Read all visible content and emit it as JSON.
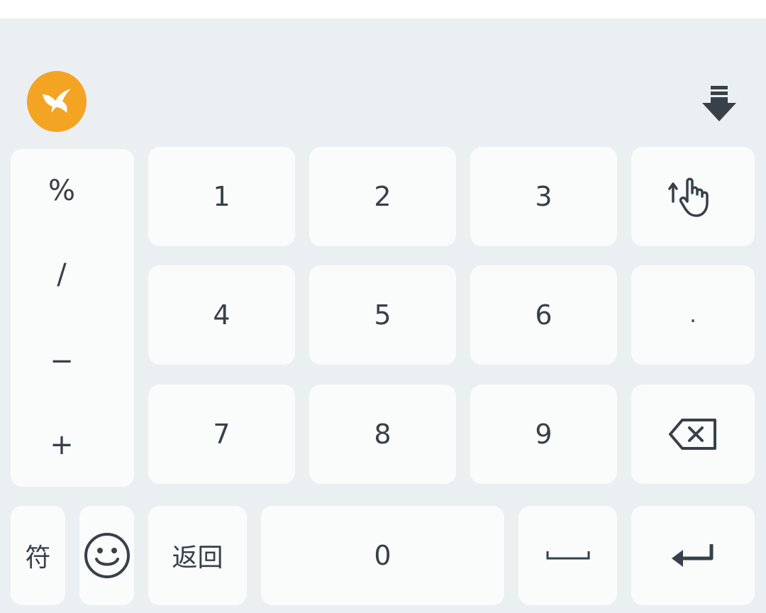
{
  "keyboard": {
    "symbols_column": [
      "%",
      "/",
      "−",
      "+"
    ],
    "digits": [
      "1",
      "2",
      "3",
      "4",
      "5",
      "6",
      "7",
      "8",
      "9"
    ],
    "zero": "0",
    "dot": ".",
    "symbols_label": "符",
    "back_label": "返回",
    "icons": {
      "logo": "hummingbird-logo-icon",
      "collapse": "keyboard-collapse-icon",
      "swipe": "swipe-up-hand-icon",
      "backspace": "backspace-icon",
      "emoji": "smiley-emoji-icon",
      "space": "space-bar-icon",
      "enter": "enter-return-icon"
    },
    "colors": {
      "panel_background": "#ebeff2",
      "key_background": "#fafbfb",
      "key_text": "#36414a",
      "logo_accent": "#f4a423"
    }
  }
}
